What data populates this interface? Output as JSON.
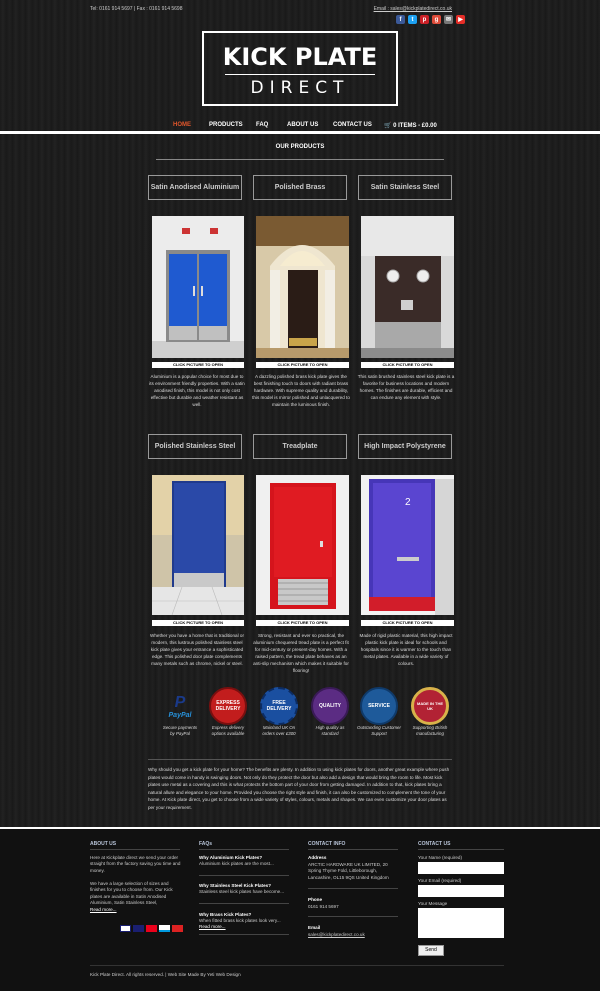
{
  "header": {
    "contact": "Tel: 0161 914 5697 | Fax : 0161 914 5698",
    "email": "Email : sales@kickplatedirect.co.uk",
    "social": [
      {
        "name": "facebook-icon",
        "glyph": "f",
        "color": "#3b5998"
      },
      {
        "name": "twitter-icon",
        "glyph": "t",
        "color": "#1da1f2"
      },
      {
        "name": "pinterest-icon",
        "glyph": "p",
        "color": "#cb2027"
      },
      {
        "name": "google-plus-icon",
        "glyph": "g",
        "color": "#dd4b39"
      },
      {
        "name": "email-icon",
        "glyph": "✉",
        "color": "#777"
      },
      {
        "name": "youtube-icon",
        "glyph": "▶",
        "color": "#e52d27"
      }
    ]
  },
  "logo": {
    "line1": "KICK PLATE",
    "line2": "DIRECT"
  },
  "nav": {
    "home": "HOME",
    "products": "PRODUCTS",
    "faq": "FAQ",
    "about": "ABOUT US",
    "contact": "CONTACT US",
    "cart": "🛒 0 ITEMS - £0.00"
  },
  "section": {
    "title": "OUR PRODUCTS"
  },
  "products": [
    {
      "name": "Satin Anodised Aluminium",
      "click": "CLICK PICTURE TO OPEN",
      "desc": "Aluminium is a popular choice for most due to its environment friendly properties. With a satin anodised finish, this model is not only cost effective but durable and weather resistant as well."
    },
    {
      "name": "Polished Brass",
      "click": "CLICK PICTURE TO OPEN",
      "desc": "A dazzling polished brass kick plate gives the best finishing touch to doors with radiant brass hardware. With supreme quality and durability, this model is mirror polished and unlacquered to maintain the luminous finish."
    },
    {
      "name": "Satin Stainless Steel",
      "click": "CLICK PICTURE TO OPEN",
      "desc": "This satin brushed stainless steel kick plate is a favorite for business locations and modern homes. The finishes are durable, efficient and can endure any element with style."
    },
    {
      "name": "Polished Stainless Steel",
      "click": "CLICK PICTURE TO OPEN",
      "desc": "Whether you have a home that is traditional or modern, this lustrous polished stainless steel kick plate gives your entrance a sophisticated edge. This polished door plate complements many metals such as chrome, nickel or steel."
    },
    {
      "name": "Treadplate",
      "click": "CLICK PICTURE TO OPEN",
      "desc": "Strong, resistant and ever so practical, the aluminium chequered tread plate is a perfect fit for mid-century or present-day homes. With a raised pattern, the tread plate behaves as an anti-slip mechanism which makes it suitable for flooring!"
    },
    {
      "name": "High Impact Polystyrene",
      "click": "CLICK PICTURE TO OPEN",
      "desc": "Made of rigid plastic material, this high impact plastic kick plate is ideal for schools and hospitals since it is warmer to the touch than metal plates. Available in a wide variety of colours."
    }
  ],
  "badges": [
    {
      "label": "PayPal",
      "caption": "Secure payments by PayPal",
      "color": "#1a3a8a"
    },
    {
      "label": "EXPRESS DELIVERY",
      "caption": "Express delivery options available",
      "color": "#c21d1d"
    },
    {
      "label": "FREE DELIVERY",
      "caption": "Mainland UK On orders over £300",
      "color": "#1a4fa0"
    },
    {
      "label": "QUALITY",
      "caption": "High quality as standard",
      "color": "#5b2c83"
    },
    {
      "label": "SERVICE",
      "caption": "Outstanding Customer Support",
      "color": "#1e5a9a"
    },
    {
      "label": "MADE IN THE UK",
      "caption": "Supporting British manufacturing",
      "color": "#b22234"
    }
  ],
  "intro": "Why should you get a kick plate for your home? The benefits are plenty. In addition to using kick plates for doors, another great example where push plates would come in handy is swinging doors. Not only do they protect the door but also add a design that would bring the room to life. Most kick plates use metal as a covering and this is what protects the bottom part of your door from getting damaged. In addition to that, kick plates bring a natural allure and elegance to your home. Provided you choose the right style and finish, it can also be customized to complement the tone of your home. At Kick plate direct, you get to choose from a wide variety of styles, colours, metals and shapes. We can even customize your door plates as per your requirement.",
  "footer": {
    "about": {
      "title": "ABOUT US",
      "p1": "Here at Kickplate direct we send your order straight from the factory saving you time and money.",
      "p2": "We have a large selection of sizes and finishes for you to choose from. Our Kick plates are available in Satin Anodised Aluminium, Satin Stainless Steel,",
      "more": "Read more..."
    },
    "faqs": {
      "title": "FAQs",
      "items": [
        {
          "q": "Why Aluminium Kick Plates?",
          "a": "Aluminium kick plates are the most..."
        },
        {
          "q": "Why Stainless Steel Kick Plates?",
          "a": "Stainless steel kick plates have become..."
        },
        {
          "q": "Why Brass Kick Plates?",
          "a": "When fitted brass kick plates look very...",
          "more": "Read more..."
        }
      ]
    },
    "contact_info": {
      "title": "CONTACT INFO",
      "addr_label": "Address",
      "addr": "ARCTIC HARDWARE UK LIMITED, 20 Spring Thyme Fold, Littleborough, Lancashire, OL15 9QS United Kingdom",
      "phone_label": "Phone",
      "phone": "0161 914 5697",
      "email_label": "Email",
      "email": "sales@kickplatedirect.co.uk"
    },
    "contact_us": {
      "title": "CONTACT US",
      "name": "Your Name (required)",
      "email": "Your Email (required)",
      "message": "Your Message",
      "send": "Send"
    },
    "copyright": "Kick Plate Direct. All rights reserved. | Web Site Made By Yeti Web Design"
  }
}
